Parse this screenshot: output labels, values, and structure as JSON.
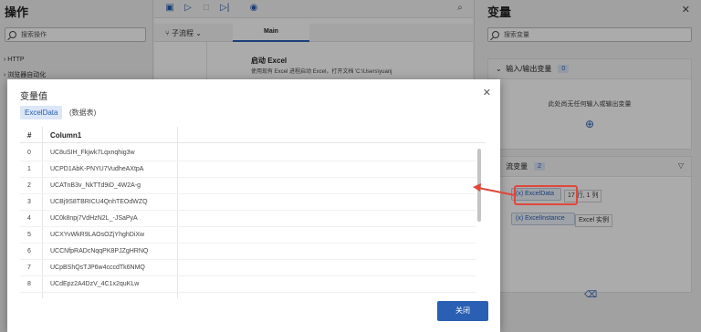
{
  "left": {
    "title": "操作",
    "search_placeholder": "搜索操作",
    "tree": [
      "HTTP",
      "浏览器自动化"
    ]
  },
  "center": {
    "subflow_label": "子流程",
    "main_tab": "Main",
    "step_title": "启动 Excel",
    "step_desc": "使用现有 Excel 进程启动 Excel，打开文档 'C:\\Users\\yuanj",
    "step_number": "1"
  },
  "right": {
    "title": "变量",
    "search_placeholder": "搜索变量",
    "io_section_label": "输入/输出变量",
    "io_count": "0",
    "io_empty_text": "此处尚无任何输入或输出变量",
    "flow_section_label": "流变量",
    "flow_count": "2",
    "variables": [
      {
        "name": "ExcelData",
        "extra": "17 行, 1 列"
      },
      {
        "name": "ExcelInstance",
        "extra": "Excel 实例"
      }
    ]
  },
  "modal": {
    "title": "变量值",
    "var_name": "ExcelData",
    "var_type": "(数据表)",
    "header_index": "#",
    "header_column": "Column1",
    "rows": [
      {
        "idx": "0",
        "val": "UC8uSIH_Fkjwk7Lqxnqhig3w"
      },
      {
        "idx": "1",
        "val": "UCPD1AbK-PNYU7VudheAXtpA"
      },
      {
        "idx": "2",
        "val": "UCATnB3v_NkTTd9iD_4W2A-g"
      },
      {
        "idx": "3",
        "val": "UCBj9S8TBRICU4QnhTEOdWZQ"
      },
      {
        "idx": "4",
        "val": "UC0k8npj7VdHzN2L_-JSaPyA"
      },
      {
        "idx": "5",
        "val": "UCXYvWkR9LAOsOZjYhghDiXw"
      },
      {
        "idx": "6",
        "val": "UCCNfpRADcNqqPK8PJZgHRNQ"
      },
      {
        "idx": "7",
        "val": "UCpBShQsTJP6w4cccdTk6NMQ"
      },
      {
        "idx": "8",
        "val": "UCdEpz2A4DzV_4C1x2quKLw"
      }
    ],
    "close_label": "关闭"
  },
  "colors": {
    "accent": "#2b5fb3",
    "highlight": "#e2463a"
  }
}
